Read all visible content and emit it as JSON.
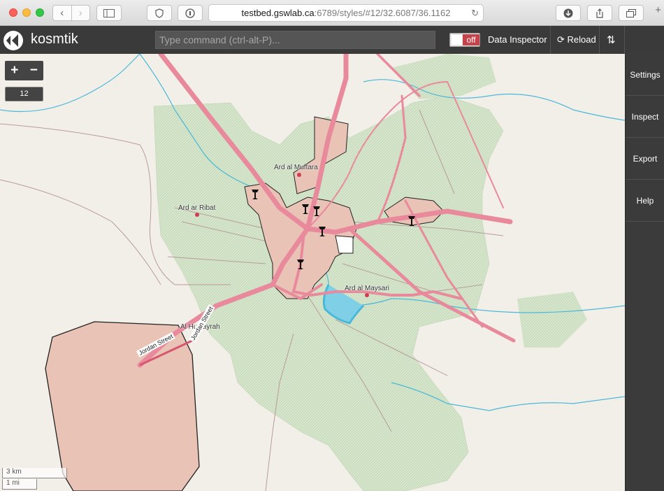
{
  "browser": {
    "url_host": "testbed.gswlab.ca",
    "url_path": ":6789/styles/#12/32.6087/36.1162"
  },
  "app": {
    "brand": "kosmtik",
    "command_placeholder": "Type command (ctrl-alt-P)...",
    "data_inspector_toggle": "off",
    "data_inspector_label": "Data Inspector",
    "reload_label": "Reload"
  },
  "sidebar": {
    "items": [
      {
        "label": "Settings"
      },
      {
        "label": "Inspect"
      },
      {
        "label": "Export"
      },
      {
        "label": "Help"
      }
    ]
  },
  "map": {
    "zoom_in": "+",
    "zoom_out": "−",
    "zoom_level": "12",
    "places": [
      {
        "name": "Ard al Muftara"
      },
      {
        "name": "Ard ar Ribat"
      },
      {
        "name": "Ard al Maysari"
      },
      {
        "name": "Al Huwayrah"
      }
    ],
    "road_labels": [
      "Jordan Street",
      "Jordan Street"
    ],
    "scale_km": "3 km",
    "scale_mi": "1 mi"
  },
  "colors": {
    "road_pink": "#e88a9c",
    "urban": "#e9c3b6",
    "farmland": "#cfe3c4",
    "water": "#3bb8d6",
    "sidebar": "#3b3b3b",
    "toggle_off": "#c6434c"
  }
}
